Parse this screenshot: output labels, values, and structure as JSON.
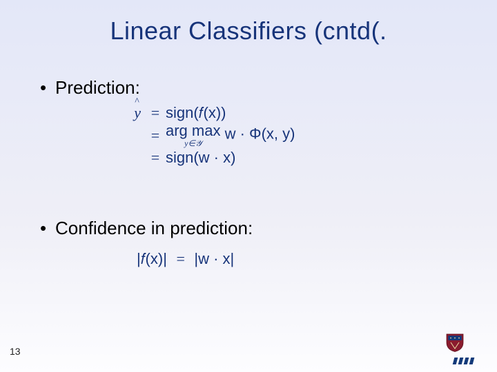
{
  "title": "Linear Classifiers (cntd(.",
  "bullets": {
    "prediction": "Prediction:",
    "confidence": "Confidence in prediction:"
  },
  "eq": {
    "yhat": "y",
    "equals": "=",
    "line1_rhs": "sign(𝑓(x))",
    "argmax": "arg max",
    "argmax_sub": "y∈𝒴",
    "line2_rhs_tail": " w · Φ(x, y)",
    "line3_rhs": "sign(w · x)",
    "conf_lhs": "|𝑓(x)|",
    "conf_rhs": "|w · x|"
  },
  "page": "13"
}
